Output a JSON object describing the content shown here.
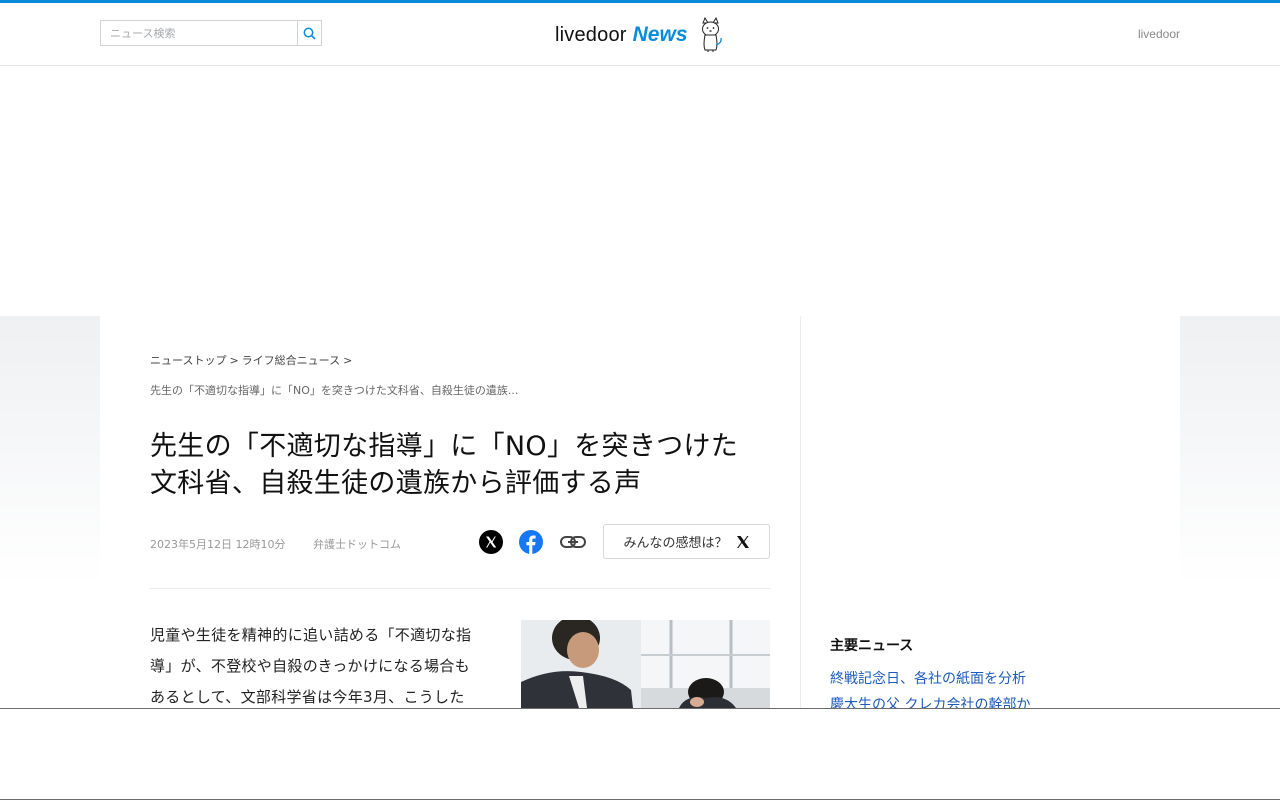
{
  "header": {
    "search_placeholder": "ニュース検索",
    "logo_text": "livedoor",
    "logo_news": "News",
    "right_link": "livedoor"
  },
  "breadcrumb": {
    "items": [
      "ニューストップ",
      "ライフ総合ニュース"
    ],
    "separator": ">",
    "current": "先生の「不適切な指導」に「NO」を突きつけた文科省、自殺生徒の遺族..."
  },
  "article": {
    "title_line1": "先生の「不適切な指導」に「NO」を突きつけた",
    "title_line2": "文科省、自殺生徒の遺族から評価する声",
    "date": "2023年5月12日 12時10分",
    "source": "弁護士ドットコム",
    "kanso_label": "みんなの感想は？",
    "body_lines": [
      "児童や生徒を精神的に追い詰める「不適切な指",
      "導」が、不登校や自殺のきっかけになる場合も",
      "あるとして、文部科学省は今年3月、こうした"
    ]
  },
  "sidebar": {
    "heading": "主要ニュース",
    "items": [
      "終戦記念日、各社の紙面を分析",
      "慶大生の父 クレカ会社の幹部か"
    ]
  },
  "colors": {
    "accent": "#0a8bd9",
    "link": "#1f5bb8"
  }
}
